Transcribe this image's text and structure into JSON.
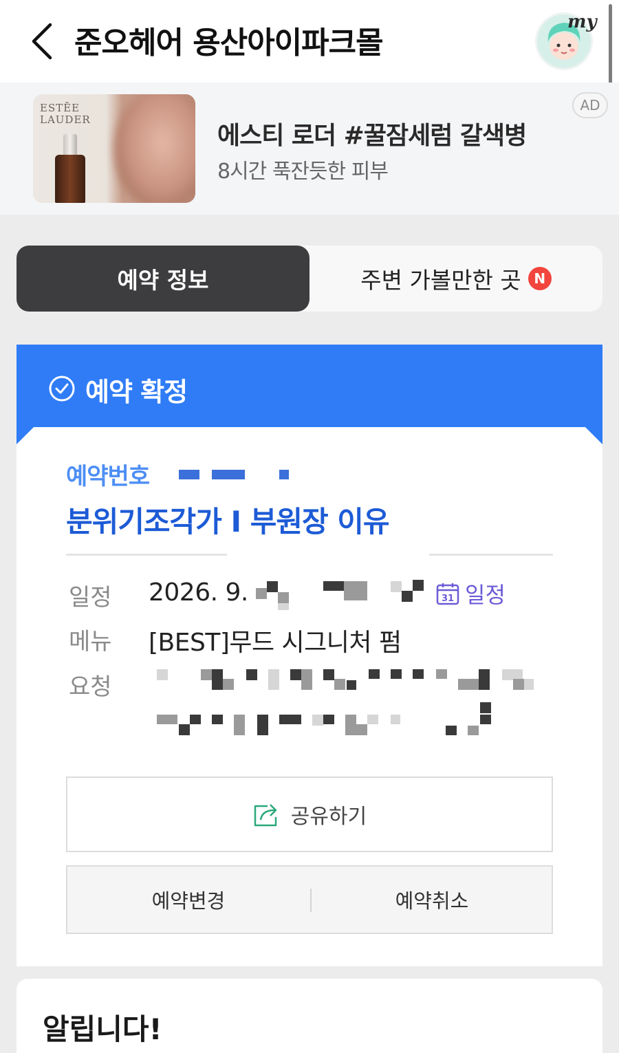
{
  "header": {
    "title": "준오헤어 용산아이파크몰",
    "back_icon": "chevron-left-icon",
    "my_label": "my"
  },
  "ad": {
    "thumb_brand": "ESTĒE\nLAUDER",
    "headline": "에스티 로더 #꿀잠세럼 갈색병",
    "subline": "8시간 푹잔듯한 피부",
    "badge": "AD"
  },
  "tabs": {
    "active_label": "예약 정보",
    "nearby_label": "주변 가볼만한 곳",
    "nearby_badge": "N"
  },
  "status": {
    "icon": "check-circle-icon",
    "text": "예약 확정"
  },
  "reservation": {
    "number_label": "예약번호",
    "designer": "분위기조각가 I 부원장 이유",
    "rows": {
      "schedule_label": "일정",
      "schedule_value": "2026. 9.",
      "menu_label": "메뉴",
      "menu_value": "[BEST]무드 시그니처 펌",
      "request_label": "요청"
    },
    "calendar_link": "일정",
    "calendar_icon_text": "31"
  },
  "actions": {
    "share_label": "공유하기",
    "change_label": "예약변경",
    "cancel_label": "예약취소"
  },
  "notice": {
    "title": "알립니다!"
  },
  "colors": {
    "accent_blue": "#2f7cf6",
    "designer_blue": "#1d5bd6",
    "tab_dark": "#3d3d3f",
    "badge_red": "#f1453d",
    "calendar_purple": "#6b5bd6",
    "share_icon_green": "#2aa87a"
  }
}
